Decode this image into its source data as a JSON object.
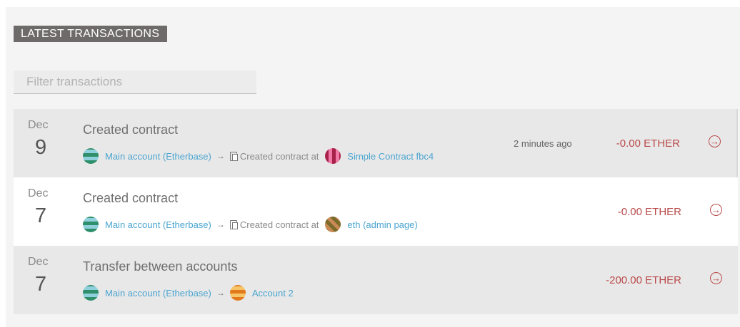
{
  "section_title": "LATEST TRANSACTIONS",
  "filter": {
    "placeholder": "Filter transactions"
  },
  "transactions": [
    {
      "month": "Dec",
      "day": "9",
      "title": "Created contract",
      "from": "Main account (Etherbase)",
      "middle": "Created contract at",
      "to": "Simple Contract fbc4",
      "time": "2 minutes ago",
      "amount": "-0.00 ETHER"
    },
    {
      "month": "Dec",
      "day": "7",
      "title": "Created contract",
      "from": "Main account (Etherbase)",
      "middle": "Created contract at",
      "to": "eth (admin page)",
      "time": "",
      "amount": "-0.00 ETHER"
    },
    {
      "month": "Dec",
      "day": "7",
      "title": "Transfer between accounts",
      "from": "Main account (Etherbase)",
      "middle": "",
      "to": "Account 2",
      "time": "",
      "amount": "-200.00 ETHER"
    }
  ],
  "arrow_glyph": "→",
  "go_glyph": "→",
  "colors": {
    "link": "#4aa5d0",
    "amount": "#b94a4a",
    "title_bg": "#6f6a6a"
  }
}
